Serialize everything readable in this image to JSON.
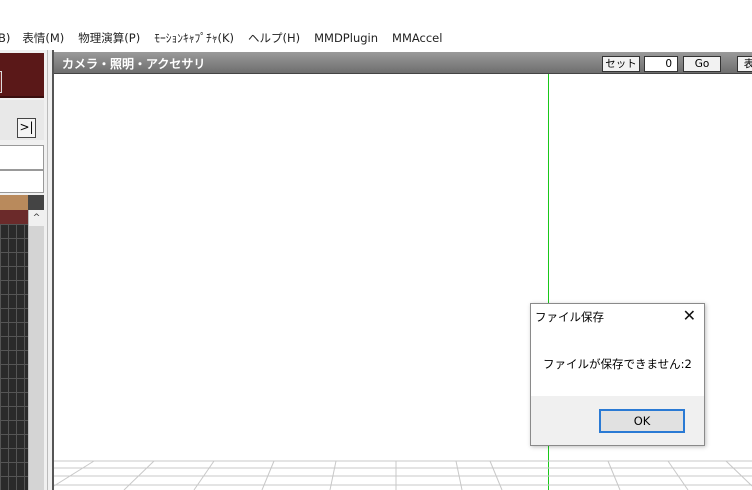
{
  "menubar": {
    "items": [
      "B)",
      "表情(M)",
      "物理演算(P)",
      "ﾓｰｼｮﾝｷｬﾌﾟﾁｬ(K)",
      "ヘルプ(H)",
      "MMDPlugin",
      "MMAccel"
    ]
  },
  "left_panel": {
    "arrow_button": ">|",
    "scroll_up": "^"
  },
  "view": {
    "title": "カメラ・照明・アクセサリ",
    "set_button": "セット",
    "frame_value": "0",
    "go_button": "Go",
    "next_button_partial": "表"
  },
  "dialog": {
    "title": "ファイル保存",
    "close_glyph": "✕",
    "message": "ファイルが保存できません:2",
    "ok_label": "OK"
  },
  "colors": {
    "axis_line": "#19c819",
    "ok_border": "#2a7ad4",
    "left_header": "#5a1818"
  }
}
